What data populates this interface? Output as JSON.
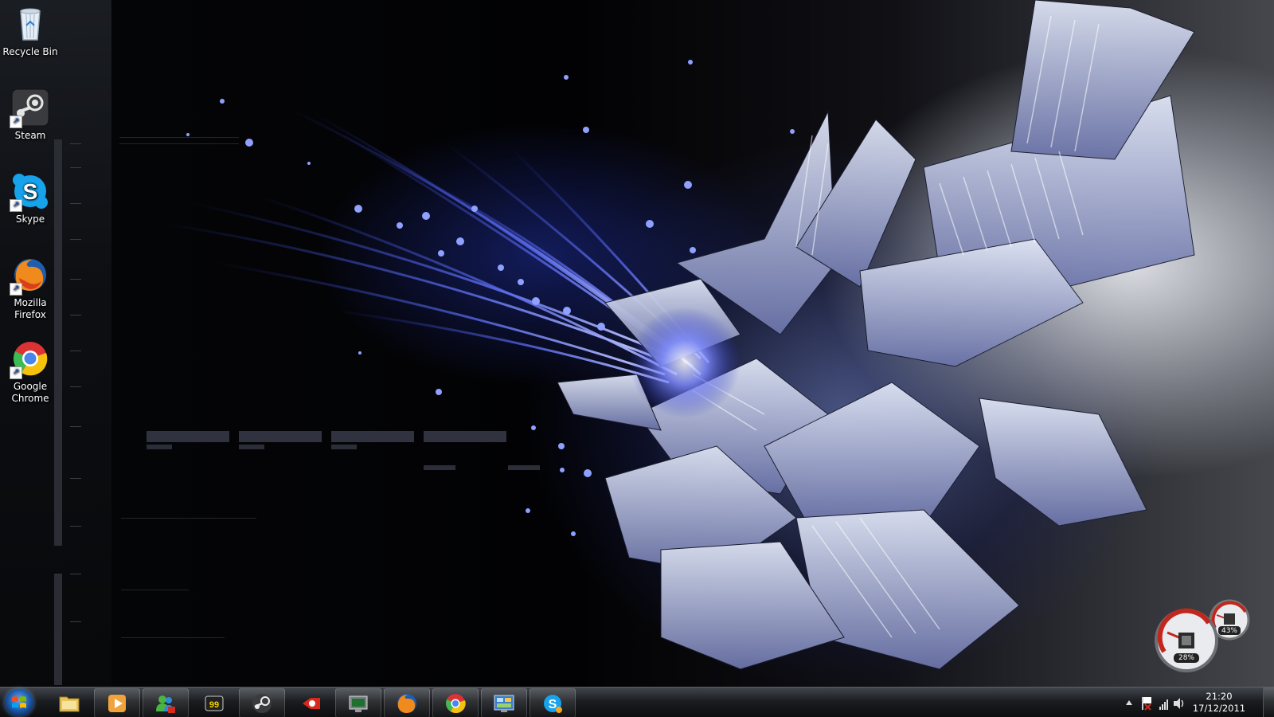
{
  "desktop": {
    "icons": [
      {
        "label": "Recycle Bin",
        "icon": "recycle-bin-icon"
      },
      {
        "label": "Steam",
        "icon": "steam-icon"
      },
      {
        "label": "Skype",
        "icon": "skype-icon"
      },
      {
        "label": "Mozilla Firefox",
        "icon": "firefox-icon"
      },
      {
        "label": "Google Chrome",
        "icon": "chrome-icon"
      }
    ]
  },
  "gadget": {
    "name": "cpu-meter",
    "cpu_percent": "28%",
    "memory_percent": "43%",
    "accent": "#c0281e"
  },
  "taskbar": {
    "pinned": [
      {
        "name": "windows-explorer",
        "icon": "folder-icon",
        "active": false
      },
      {
        "name": "windows-media-player",
        "icon": "media-player-icon",
        "active": true
      },
      {
        "name": "windows-live-messenger",
        "icon": "messenger-icon",
        "active": true
      },
      {
        "name": "fraps",
        "icon": "fraps-icon",
        "active": false
      },
      {
        "name": "steam",
        "icon": "steam-icon",
        "active": true
      },
      {
        "name": "logmein-hamachi",
        "icon": "hamachi-icon",
        "active": false
      },
      {
        "name": "cpu-z",
        "icon": "cpuz-icon",
        "active": true
      },
      {
        "name": "mozilla-firefox",
        "icon": "firefox-icon",
        "active": true
      },
      {
        "name": "google-chrome",
        "icon": "chrome-icon",
        "active": true
      },
      {
        "name": "control-panel",
        "icon": "control-panel-icon",
        "active": true
      },
      {
        "name": "skype",
        "icon": "skype-icon",
        "active": true
      }
    ],
    "tray": {
      "icons": [
        "show-hidden-icons-arrow-icon",
        "action-center-flag-icon",
        "network-signal-icon",
        "volume-icon"
      ],
      "time": "21:20",
      "date": "17/12/2011"
    }
  },
  "colors": {
    "taskbar": "#1c1e22",
    "start_orb": "#1f5fb3",
    "accent_blue": "#3a4fd6"
  }
}
